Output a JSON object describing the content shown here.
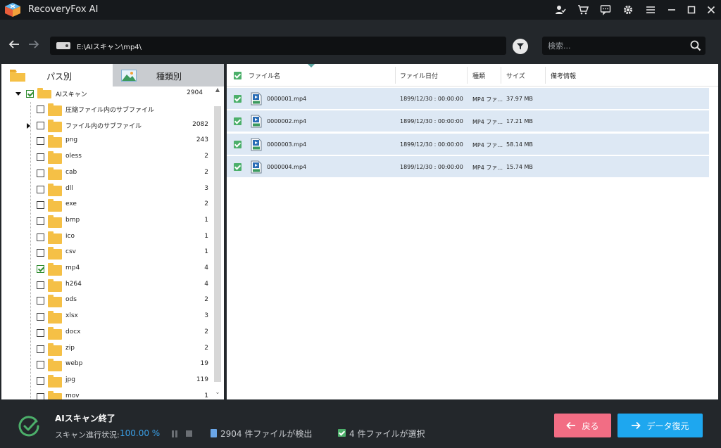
{
  "app": {
    "title": "RecoveryFox AI",
    "colors": {
      "accent": "#1ea7ef",
      "back_button": "#f26d84",
      "selected_row": "#dde8f4",
      "check_green": "#4caf6a",
      "folder": "#f5c046"
    }
  },
  "titlebar_icons": [
    "user-check-icon",
    "cart-icon",
    "chat-icon",
    "gear-icon",
    "menu-icon",
    "minimize-icon",
    "maximize-icon",
    "close-icon"
  ],
  "address": {
    "path": "E:\\AIスキャン\\mp4\\",
    "search_placeholder": "検索..."
  },
  "tabs": [
    {
      "label": "パス別",
      "active": true
    },
    {
      "label": "種類別",
      "active": false
    }
  ],
  "tree": {
    "root": {
      "label": "AIスキャン",
      "count": "2904",
      "checked": true
    },
    "items": [
      {
        "label": "圧縮ファイル内のサブファイル",
        "count": "",
        "checked": false,
        "expandable": false,
        "special": true
      },
      {
        "label": "ファイル内のサブファイル",
        "count": "2082",
        "checked": false,
        "expandable": true,
        "special": true
      },
      {
        "label": "png",
        "count": "243",
        "checked": false
      },
      {
        "label": "oless",
        "count": "2",
        "checked": false
      },
      {
        "label": "cab",
        "count": "2",
        "checked": false
      },
      {
        "label": "dll",
        "count": "3",
        "checked": false
      },
      {
        "label": "exe",
        "count": "2",
        "checked": false
      },
      {
        "label": "bmp",
        "count": "1",
        "checked": false
      },
      {
        "label": "ico",
        "count": "1",
        "checked": false
      },
      {
        "label": "csv",
        "count": "1",
        "checked": false
      },
      {
        "label": "mp4",
        "count": "4",
        "checked": true
      },
      {
        "label": "h264",
        "count": "4",
        "checked": false
      },
      {
        "label": "ods",
        "count": "2",
        "checked": false
      },
      {
        "label": "xlsx",
        "count": "3",
        "checked": false
      },
      {
        "label": "docx",
        "count": "2",
        "checked": false
      },
      {
        "label": "zip",
        "count": "2",
        "checked": false
      },
      {
        "label": "webp",
        "count": "19",
        "checked": false
      },
      {
        "label": "jpg",
        "count": "119",
        "checked": false
      },
      {
        "label": "mov",
        "count": "1",
        "checked": false
      }
    ]
  },
  "table": {
    "headers": {
      "name": "ファイル名",
      "date": "ファイル日付",
      "type": "種類",
      "size": "サイズ",
      "notes": "備考情報"
    },
    "rows": [
      {
        "name": "0000001.mp4",
        "date": "1899/12/30 : 00:00:00",
        "type": "MP4 ファ...",
        "size": "37.97 MB"
      },
      {
        "name": "0000002.mp4",
        "date": "1899/12/30 : 00:00:00",
        "type": "MP4 ファ...",
        "size": "17.21 MB"
      },
      {
        "name": "0000003.mp4",
        "date": "1899/12/30 : 00:00:00",
        "type": "MP4 ファ...",
        "size": "58.14 MB"
      },
      {
        "name": "0000004.mp4",
        "date": "1899/12/30 : 00:00:00",
        "type": "MP4 ファ...",
        "size": "15.74 MB"
      }
    ]
  },
  "status": {
    "title": "AIスキャン終了",
    "progress_label": "スキャン進行状況:",
    "progress_value": "100.00 %",
    "found_num": "2904",
    "found_text": " 件ファイルが検出",
    "selected_text": "4 件ファイルが選択"
  },
  "buttons": {
    "back": "戻る",
    "recover": "データ復元"
  }
}
